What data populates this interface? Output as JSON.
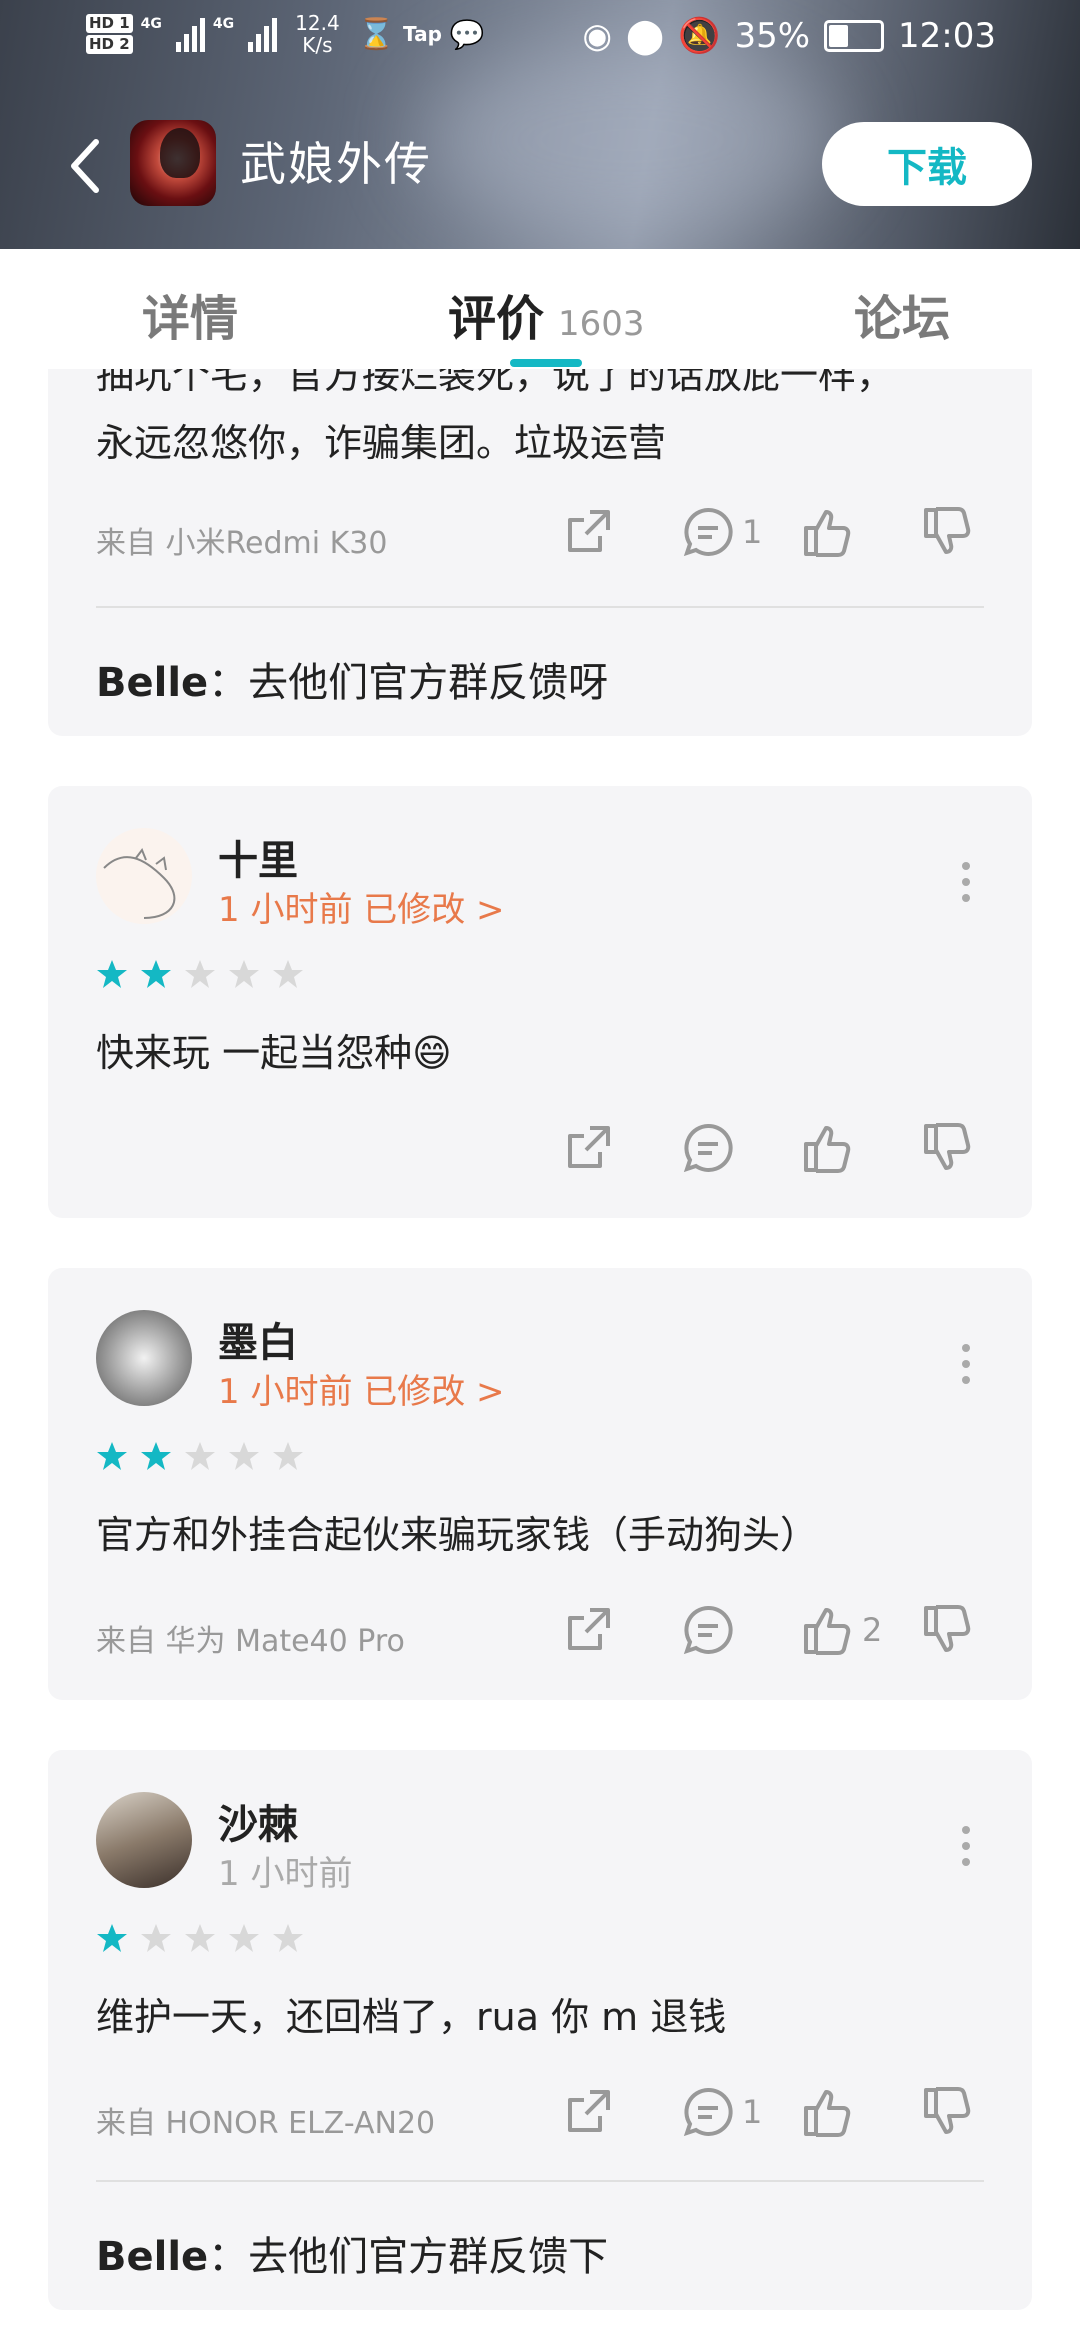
{
  "status": {
    "hd1": "HD 1",
    "hd2": "HD 2",
    "net": "4G",
    "speed_value": "12.4",
    "speed_unit": "K/s",
    "battery": "35%",
    "time": "12:03",
    "app_badge": "Tap"
  },
  "header": {
    "back_icon": "back-arrow-icon",
    "app_title": "武娘外传",
    "download_label": "下载"
  },
  "tabs": [
    {
      "label": "详情"
    },
    {
      "label": "评价",
      "count": "1603"
    },
    {
      "label": "论坛"
    }
  ],
  "colors": {
    "accent": "#14b8c4",
    "time_orange": "#e8794a",
    "card_bg": "#f5f5f7"
  },
  "reviews": [
    {
      "text_partial": "抽坑个宅，官方接烂装死，说了的话放屁一样，",
      "text": "永远忽悠你，诈骗集团。垃圾运营",
      "device": "来自 小米Redmi K30",
      "comments": "1",
      "likes": "",
      "reply_user": "Belle",
      "reply_text": "：去他们官方群反馈呀"
    },
    {
      "user": "十里",
      "time": "1 小时前 已修改 >",
      "rating": 2,
      "text": "快来玩 一起当怨种😄",
      "comments": "",
      "likes": ""
    },
    {
      "user": "墨白",
      "time": "1 小时前 已修改 >",
      "rating": 2,
      "text": "官方和外挂合起伙来骗玩家钱（手动狗头）",
      "device": "来自 华为 Mate40 Pro",
      "comments": "",
      "likes": "2"
    },
    {
      "user": "沙棘",
      "time": "1 小时前",
      "rating": 1,
      "text": "维护一天，还回档了，rua 你 m 退钱",
      "device": "来自 HONOR ELZ-AN20",
      "comments": "1",
      "likes": "",
      "reply_user": "Belle",
      "reply_text": "：去他们官方群反馈下"
    }
  ]
}
